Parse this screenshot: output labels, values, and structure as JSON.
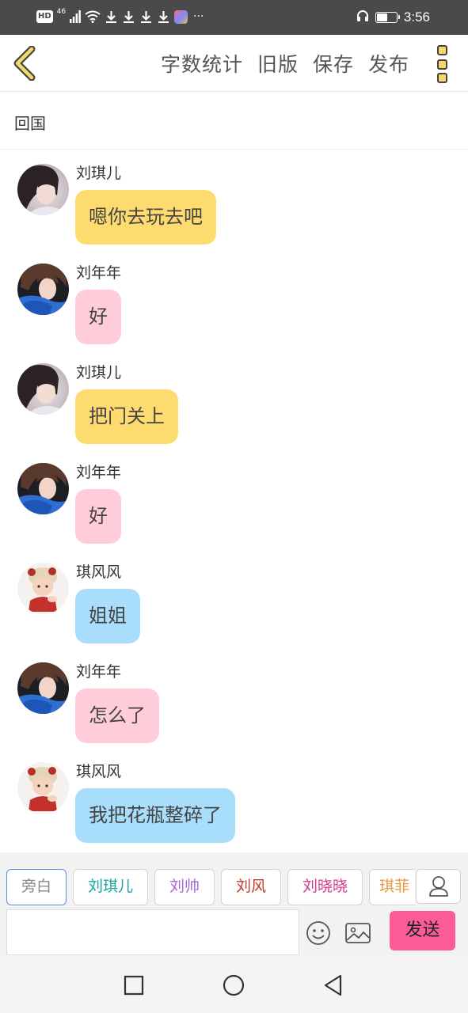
{
  "status_bar": {
    "hd": "HD",
    "signal_label": "46",
    "more": "···",
    "time": "3:56",
    "battery_level": 0.55
  },
  "toolbar": {
    "back_icon": "chevron-left-icon",
    "actions": [
      "字数统计",
      "旧版",
      "保存",
      "发布"
    ],
    "more_icon": "more-vertical-icon"
  },
  "title": "回国",
  "messages": [
    {
      "sender": "刘琪儿",
      "text": "嗯你去玩去吧",
      "color": "#fddb6f",
      "avatar": "avatar-liuqier"
    },
    {
      "sender": "刘年年",
      "text": "好",
      "color": "#ffcdd9",
      "avatar": "avatar-liunian"
    },
    {
      "sender": "刘琪儿",
      "text": "把门关上",
      "color": "#fddb6f",
      "avatar": "avatar-liuqier"
    },
    {
      "sender": "刘年年",
      "text": "好",
      "color": "#ffcdd9",
      "avatar": "avatar-liunian"
    },
    {
      "sender": "琪风风",
      "text": "姐姐",
      "color": "#a8defb",
      "avatar": "avatar-qifengfeng"
    },
    {
      "sender": "刘年年",
      "text": "怎么了",
      "color": "#ffcdd9",
      "avatar": "avatar-liunian"
    },
    {
      "sender": "琪风风",
      "text": "我把花瓶整碎了",
      "color": "#a8defb",
      "avatar": "avatar-qifengfeng"
    }
  ],
  "characters": [
    {
      "name": "旁白",
      "color": "#888888"
    },
    {
      "name": "刘琪儿",
      "color": "#1aa3a0"
    },
    {
      "name": "刘帅",
      "color": "#a666d6"
    },
    {
      "name": "刘风",
      "color": "#c0392b"
    },
    {
      "name": "刘晓晓",
      "color": "#d4388c"
    },
    {
      "name": "琪菲",
      "color": "#e8983d"
    }
  ],
  "composer": {
    "input_value": "",
    "emoji_icon": "emoji-icon",
    "image_icon": "image-icon",
    "send_label": "发送",
    "user_icon": "user-icon"
  },
  "nav": {
    "recent_icon": "square-icon",
    "home_icon": "circle-icon",
    "back_icon": "triangle-back-icon"
  }
}
